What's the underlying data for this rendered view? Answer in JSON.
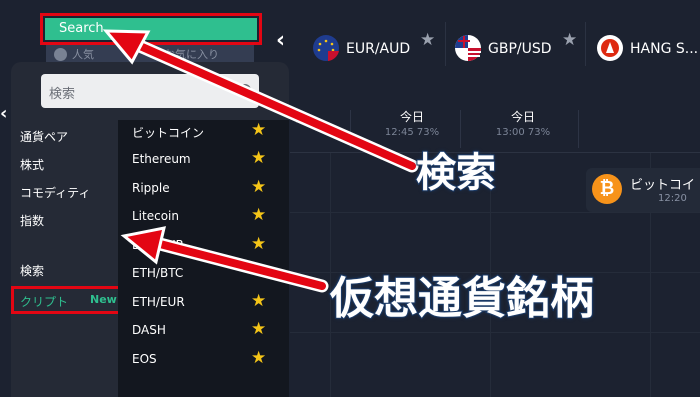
{
  "topbar": {
    "search_label": "Search",
    "favorites_label": "お気に入り",
    "favorites_prefix": "人気",
    "assets": [
      {
        "name": "EUR/AUD",
        "icon": "eu-au-flag-icon"
      },
      {
        "name": "GBP/USD",
        "icon": "uk-us-flag-icon"
      },
      {
        "name": "HANG S...",
        "icon": "hang-seng-icon"
      }
    ]
  },
  "timebar": {
    "cols": [
      {
        "day": "日",
        "sub": ""
      },
      {
        "day": "今日",
        "sub": "12:45    73%"
      },
      {
        "day": "今日",
        "sub": "13:00    73%"
      }
    ]
  },
  "btc_card": {
    "name": "ビットコイ",
    "time": "12:20",
    "symbol": "₿"
  },
  "panel": {
    "search_placeholder": "検索",
    "categories": [
      "通貨ペア",
      "株式",
      "コモディティ",
      "指数",
      "検索"
    ],
    "active_category": {
      "label": "クリプト",
      "badge": "New"
    },
    "items": [
      {
        "name": "ビットコイン",
        "starred": true
      },
      {
        "name": "Ethereum",
        "starred": true
      },
      {
        "name": "Ripple",
        "starred": true
      },
      {
        "name": "Litecoin",
        "starred": true
      },
      {
        "name": "BTC/EUR",
        "starred": true
      },
      {
        "name": "ETH/BTC",
        "starred": false
      },
      {
        "name": "ETH/EUR",
        "starred": true
      },
      {
        "name": "DASH",
        "starred": true
      },
      {
        "name": "EOS",
        "starred": true
      }
    ]
  },
  "annotations": {
    "search": "検索",
    "crypto": "仮想通貨銘柄"
  },
  "colors": {
    "accent": "#2fbf8f",
    "highlight": "#e30613",
    "star": "#f5c518",
    "background": "#1c2230"
  }
}
